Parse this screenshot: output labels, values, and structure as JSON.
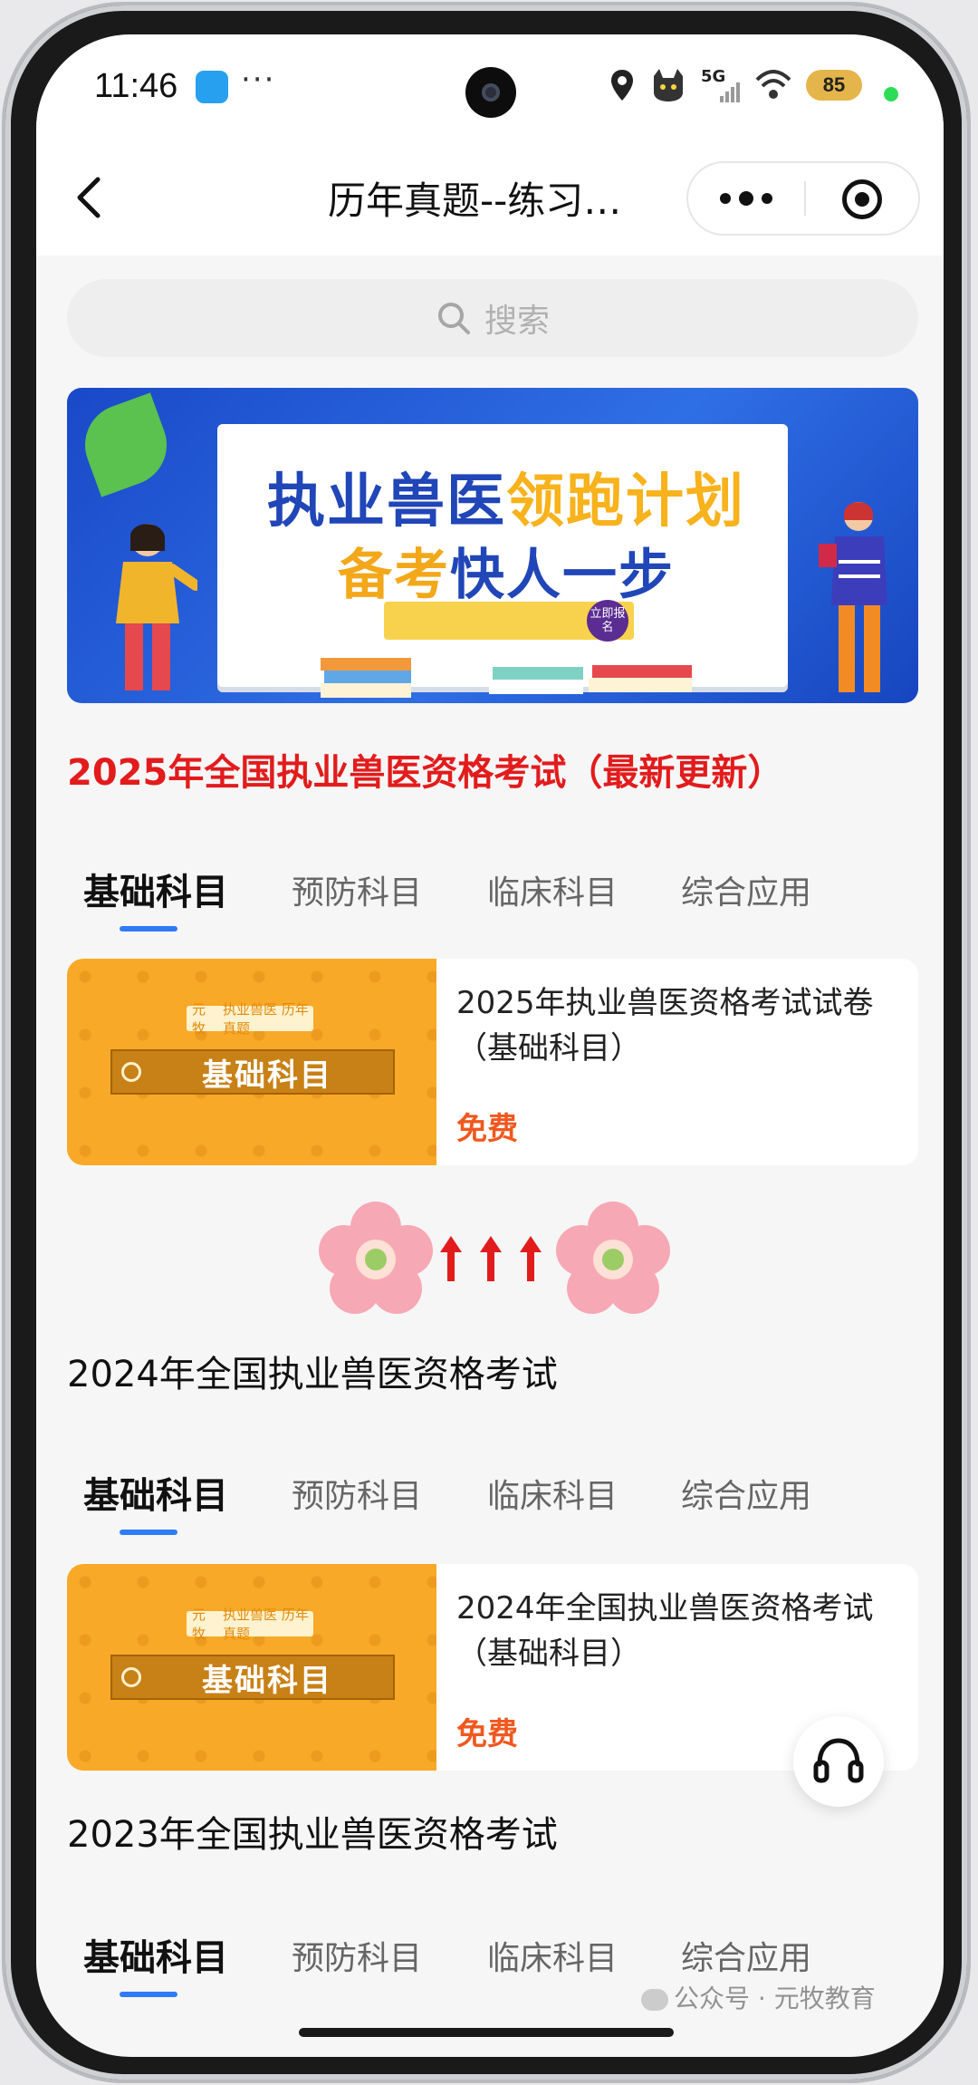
{
  "status_bar": {
    "time": "11:46",
    "dots": "···",
    "network": "5G",
    "battery": "85"
  },
  "nav": {
    "title": "历年真题--练习…"
  },
  "search": {
    "placeholder": "搜索"
  },
  "banner": {
    "line1_a": "执业兽医",
    "line1_b": "领跑计划",
    "line2_a": "备考",
    "line2_b": "快人一步",
    "badge": "立即报名"
  },
  "sections": [
    {
      "title": "2025年全国执业兽医资格考试（最新更新）",
      "tabs": [
        "基础科目",
        "预防科目",
        "临床科目",
        "综合应用"
      ],
      "card": {
        "thumb_brand": "元牧",
        "thumb_tag": "执业兽医 历年真题",
        "thumb_label": "基础科目",
        "title": "2025年执业兽医资格考试试卷（基础科目）",
        "price": "免费"
      }
    },
    {
      "title": "2024年全国执业兽医资格考试",
      "tabs": [
        "基础科目",
        "预防科目",
        "临床科目",
        "综合应用"
      ],
      "card": {
        "thumb_brand": "元牧",
        "thumb_tag": "执业兽医 历年真题",
        "thumb_label": "基础科目",
        "title": "2024年全国执业兽医资格考试（基础科目）",
        "price": "免费"
      }
    },
    {
      "title": "2023年全国执业兽医资格考试",
      "tabs": [
        "基础科目",
        "预防科目",
        "临床科目",
        "综合应用"
      ]
    }
  ],
  "divider_arrows": "↑↑↑",
  "watermark": "公众号 · 元牧教育",
  "colors": {
    "accent_blue": "#2f7bf6",
    "title_red": "#e21c1c",
    "price_orange": "#f0581f",
    "thumb_orange": "#f8a928"
  }
}
